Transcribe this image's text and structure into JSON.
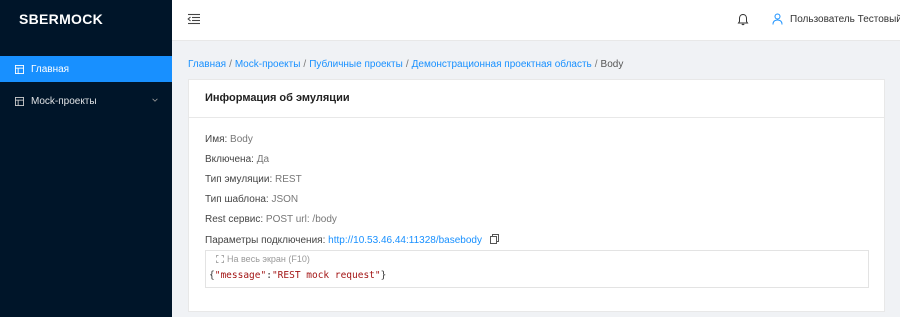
{
  "app": {
    "logo": "SBERMOCK"
  },
  "sidebar": {
    "items": [
      {
        "label": "Главная",
        "active": true
      },
      {
        "label": "Mock-проекты",
        "active": false
      }
    ]
  },
  "header": {
    "user_name": "Пользователь Тестовый"
  },
  "breadcrumb": [
    "Главная",
    "Mock-проекты",
    "Публичные проекты",
    "Демонстрационная проектная область",
    "Body"
  ],
  "card": {
    "title": "Информация об эмуляции",
    "fields": {
      "name": {
        "label": "Имя:",
        "value": "Body"
      },
      "enabled": {
        "label": "Включена:",
        "value": "Да"
      },
      "type": {
        "label": "Тип эмуляции:",
        "value": "REST"
      },
      "template": {
        "label": "Тип шаблона:",
        "value": "JSON"
      },
      "rest": {
        "label": "Rest сервис:",
        "value": "POST url: /body"
      },
      "connection": {
        "label": "Параметры подключения:",
        "value": "http://10.53.46.44:11328/basebody"
      }
    },
    "editor": {
      "fullscreen_label": "На весь экран (F10)",
      "code": {
        "open": "{",
        "key": "\"message\"",
        "colon": ":",
        "value": "\"REST mock request\"",
        "close": "}"
      }
    }
  },
  "colors": {
    "sidebar_bg": "#001529",
    "accent": "#1890ff",
    "page_bg": "#f0f2f5"
  }
}
